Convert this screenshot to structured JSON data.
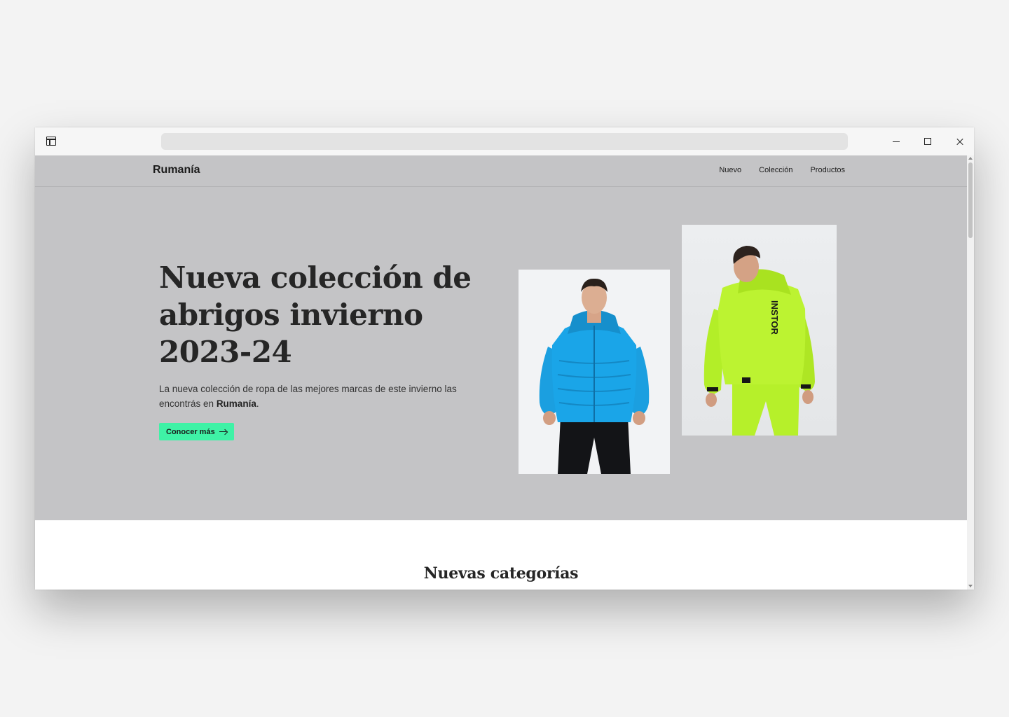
{
  "browser": {
    "address": ""
  },
  "nav": {
    "brand": "Rumanía",
    "links": [
      "Nuevo",
      "Colección",
      "Productos"
    ]
  },
  "hero": {
    "title": "Nueva colección de abrigos invierno 2023-24",
    "subtitle_prefix": "La nueva colección de ropa de las mejores marcas de este invierno las encontrás en ",
    "subtitle_brand": "Rumanía",
    "subtitle_suffix": ".",
    "cta_label": "Conocer más",
    "images": [
      {
        "name": "blue-jacket-model",
        "jacket_color": "#1aa5e8"
      },
      {
        "name": "green-jacket-model",
        "jacket_color": "#b8f22c",
        "print_text": "INSTOR"
      }
    ]
  },
  "sections": {
    "categories_title": "Nuevas categorías"
  },
  "colors": {
    "hero_bg": "#c4c4c6",
    "accent": "#3ff2a6",
    "text": "#262626"
  }
}
